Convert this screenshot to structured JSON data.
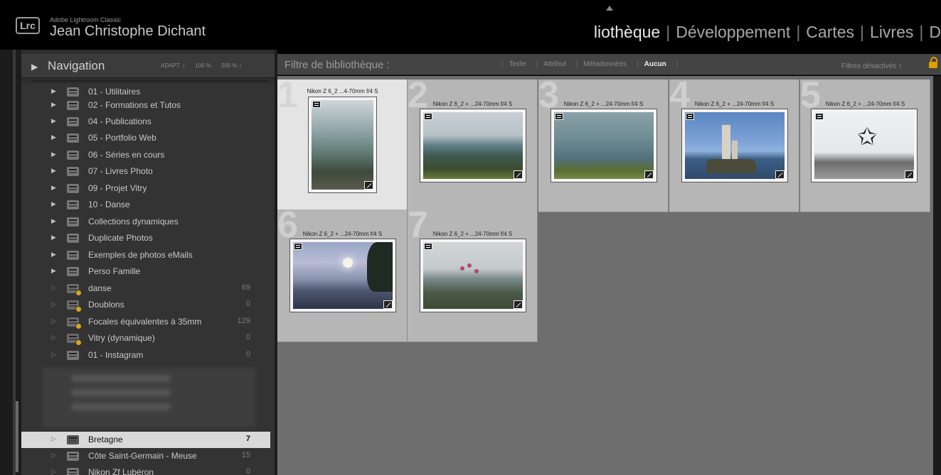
{
  "app": {
    "small_title": "Adobe Lightroom Classic",
    "user": "Jean Christophe Dichant",
    "logo": "Lrc"
  },
  "modules": [
    {
      "label": "liothèque",
      "active": true
    },
    {
      "label": "Développement",
      "active": false
    },
    {
      "label": "Cartes",
      "active": false
    },
    {
      "label": "Livres",
      "active": false
    },
    {
      "label": "D",
      "active": false
    }
  ],
  "navigator": {
    "title": "Navigation",
    "zoom_fit": "ADAPT. ↕",
    "zoom_100": "100 %",
    "zoom_200": "200 % ↕"
  },
  "collections": [
    {
      "label": "01 - Utilitaires",
      "count": "",
      "type": "set"
    },
    {
      "label": "02 - Formations et Tutos",
      "count": "",
      "type": "set"
    },
    {
      "label": "04 - Publications",
      "count": "",
      "type": "set"
    },
    {
      "label": "05 - Portfolio Web",
      "count": "",
      "type": "set"
    },
    {
      "label": "06 - Séries en cours",
      "count": "",
      "type": "set"
    },
    {
      "label": "07 - Livres Photo",
      "count": "",
      "type": "set"
    },
    {
      "label": "09 - Projet Vitry",
      "count": "",
      "type": "set"
    },
    {
      "label": "10 - Danse",
      "count": "",
      "type": "set"
    },
    {
      "label": "Collections dynamiques",
      "count": "",
      "type": "set"
    },
    {
      "label": "Duplicate Photos",
      "count": "",
      "type": "set"
    },
    {
      "label": "Exemples de photos eMails",
      "count": "",
      "type": "set"
    },
    {
      "label": "Perso Famille",
      "count": "",
      "type": "set"
    },
    {
      "label": "danse",
      "count": "69",
      "type": "smart"
    },
    {
      "label": "Doublons",
      "count": "0",
      "type": "smart"
    },
    {
      "label": "Focales équivalentes à 35mm",
      "count": "129",
      "type": "smart"
    },
    {
      "label": "Vitry (dynamique)",
      "count": "0",
      "type": "smart"
    },
    {
      "label": "01 - Instagram",
      "count": "0",
      "type": "collection"
    }
  ],
  "collections_bottom": [
    {
      "label": "Bretagne",
      "count": "7",
      "selected": true
    },
    {
      "label": "Côte Saint-Germain - Meuse",
      "count": "15",
      "selected": false
    },
    {
      "label": "Nikon Zf Lubéron",
      "count": "0",
      "selected": false
    }
  ],
  "filter_bar": {
    "title": "Filtre de bibliothèque :",
    "items": [
      "Texte",
      "Attribut",
      "Métadonnées",
      "Aucun"
    ],
    "active_item": "Aucun",
    "status": "Filtres désactivés ↕"
  },
  "grid": [
    {
      "index": "1",
      "meta": "Nikon Z 6_2 ...4-70mm f/4 S",
      "selected": true,
      "orientation": "portrait",
      "photo": "coastal-bay-portrait"
    },
    {
      "index": "2",
      "meta": "Nikon Z 6_2 + ...24-70mm f/4 S",
      "selected": false,
      "orientation": "landscape",
      "photo": "sea-with-flowers"
    },
    {
      "index": "3",
      "meta": "Nikon Z 6_2 + ...24-70mm f/4 S",
      "selected": false,
      "orientation": "landscape",
      "photo": "harbor-boats"
    },
    {
      "index": "4",
      "meta": "Nikon Z 6_2 + ...24-70mm f/4 S",
      "selected": false,
      "orientation": "landscape",
      "photo": "lighthouse"
    },
    {
      "index": "5",
      "meta": "Nikon Z 6_2 + ...24-70mm f/4 S",
      "selected": false,
      "orientation": "landscape",
      "photo": "jumping-silhouette"
    },
    {
      "index": "6",
      "meta": "Nikon Z 6_2 + ...24-70mm f/4 S",
      "selected": false,
      "orientation": "landscape",
      "photo": "moonlit-sea"
    },
    {
      "index": "7",
      "meta": "Nikon Z 6_2 + ...24-70mm f/4 S",
      "selected": false,
      "orientation": "landscape",
      "photo": "coastal-flowers"
    }
  ],
  "colors": {
    "accent_lock": "#e0a000",
    "selection": "#d9d9d9"
  }
}
